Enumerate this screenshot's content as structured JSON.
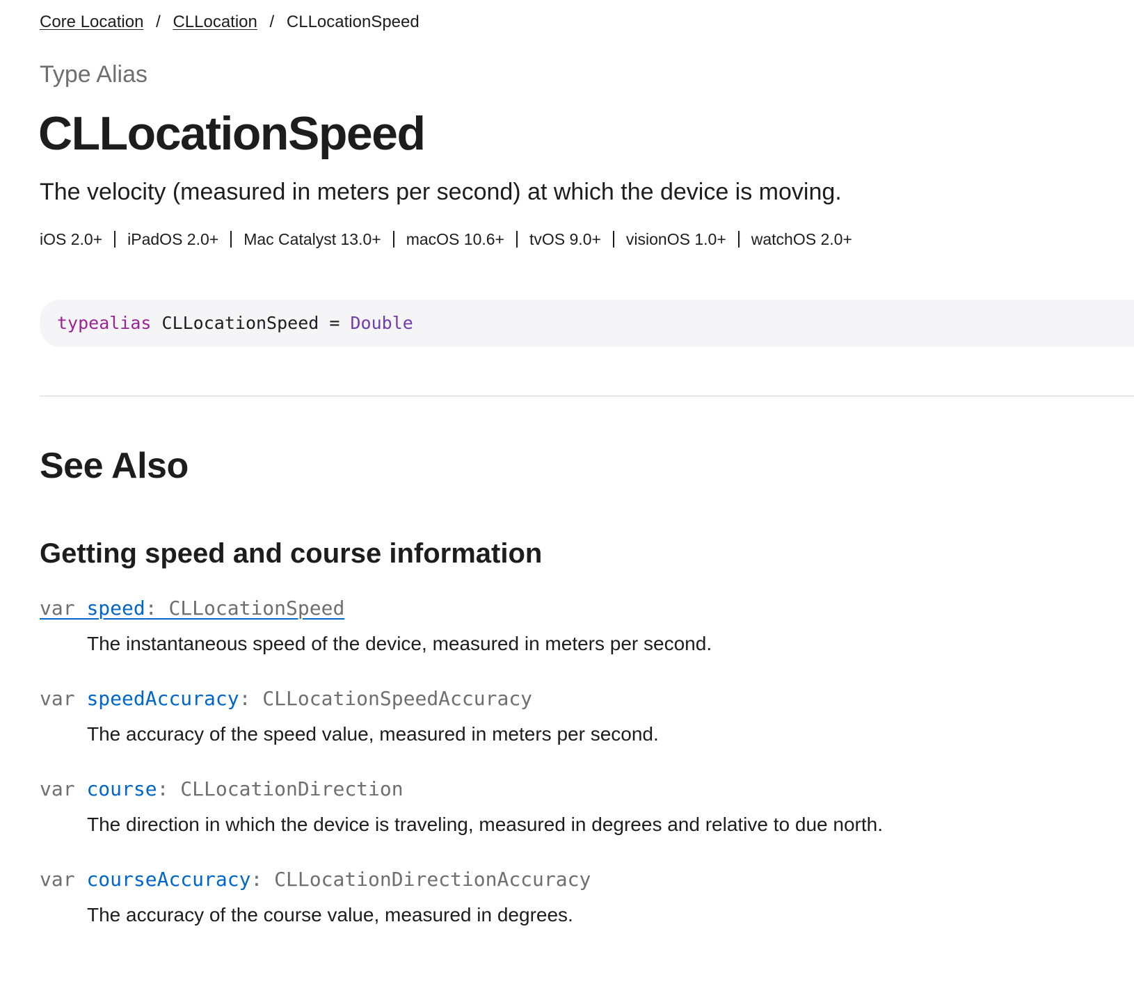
{
  "breadcrumb": {
    "items": [
      {
        "label": "Core Location"
      },
      {
        "label": "CLLocation"
      }
    ],
    "separator": "/",
    "current": "CLLocationSpeed"
  },
  "eyebrow": "Type Alias",
  "title": "CLLocationSpeed",
  "abstract": "The velocity (measured in meters per second) at which the device is moving.",
  "platforms": [
    "iOS 2.0+",
    "iPadOS 2.0+",
    "Mac Catalyst 13.0+",
    "macOS 10.6+",
    "tvOS 9.0+",
    "visionOS 1.0+",
    "watchOS 2.0+"
  ],
  "declaration": {
    "keyword": "typealias",
    "name": "CLLocationSpeed",
    "operator": "=",
    "type": "Double"
  },
  "see_also": {
    "title": "See Also",
    "group_title": "Getting speed and course information",
    "topics": [
      {
        "keyword": "var",
        "name": "speed",
        "type": ": CLLocationSpeed",
        "abstract": "The instantaneous speed of the device, measured in meters per second."
      },
      {
        "keyword": "var",
        "name": "speedAccuracy",
        "type": ": CLLocationSpeedAccuracy",
        "abstract": "The accuracy of the speed value, measured in meters per second."
      },
      {
        "keyword": "var",
        "name": "course",
        "type": ": CLLocationDirection",
        "abstract": "The direction in which the device is traveling, measured in degrees and relative to due north."
      },
      {
        "keyword": "var",
        "name": "courseAccuracy",
        "type": ": CLLocationDirectionAccuracy",
        "abstract": "The accuracy of the course value, measured in degrees."
      }
    ]
  },
  "colors": {
    "text": "#1d1d1f",
    "muted": "#6e6e73",
    "link": "#0066cc",
    "keyword": "#9b2393",
    "type": "#703daa",
    "code_background": "#f5f5f7",
    "divider": "#d2d2d7"
  }
}
